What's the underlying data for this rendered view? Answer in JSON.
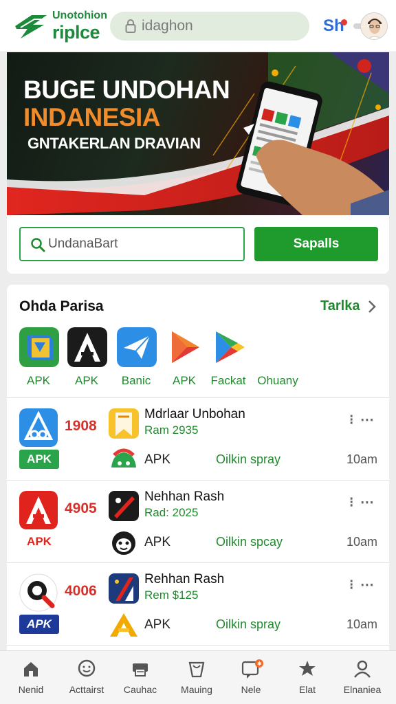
{
  "header": {
    "logo_line1": "Unotohion",
    "logo_line2": "riplce",
    "search_placeholder": "idaghon",
    "sh_label": "Sh",
    "colors": {
      "brand": "#1c8a3a",
      "accent": "#2f6bd1",
      "notify": "#e53935"
    }
  },
  "banner": {
    "title_line1": "BUGE UNDOHAN",
    "title_line2": "INDANESIA",
    "subtitle": "GNTAKERLAN DRAVIAN",
    "colors": {
      "title": "#ffffff",
      "title_accent": "#f28b2a",
      "stripe_red": "#d0241d",
      "stripe_green": "#1f8a2d"
    }
  },
  "promo": {
    "input_value": "UndanaBart",
    "button_label": "Sapalls"
  },
  "section": {
    "title": "Ohda Parisa",
    "link": "Tarlka"
  },
  "categories": [
    {
      "label": "APK",
      "icon": "book-app-icon",
      "color": "#2ea043"
    },
    {
      "label": "APK",
      "icon": "a-logo-app-icon",
      "color": "#111111"
    },
    {
      "label": "Banic",
      "icon": "paper-plane-app-icon",
      "color": "#2d8ee6"
    },
    {
      "label": "APK",
      "icon": "play-triangle-icon",
      "color": "#e53935"
    },
    {
      "label": "Fackat",
      "icon": "google-play-icon",
      "color": "#34a853"
    },
    {
      "label": "Ohuany",
      "icon": "",
      "color": ""
    }
  ],
  "apps": [
    {
      "rank": "1908",
      "name": "Mdrlaar Unbohan",
      "meta": "Ram 2935",
      "tag": "APK",
      "apk": "APK",
      "spray": "Oilkin spray",
      "time": "10am",
      "icon": "a-triangle-blue-icon",
      "small_icon": "bookmark-yellow-icon",
      "tag2_icon": "green-blob-icon"
    },
    {
      "rank": "4905",
      "name": "Nehhan Rash",
      "meta": "Rad: 2025",
      "tag": "APK",
      "apk": "APK",
      "spray": "Oilkin spcay",
      "time": "10am",
      "icon": "a-red-logo-icon",
      "small_icon": "slash-app-icon",
      "tag2_icon": "panda-face-icon"
    },
    {
      "rank": "4006",
      "name": "Rehhan Rash",
      "meta": "Rem $125",
      "tag": "APK",
      "apk": "APK",
      "spray": "Oilkin spray",
      "time": "10am",
      "icon": "magnifier-logo-icon",
      "small_icon": "flag-app-icon",
      "tag2_icon": "a-yellow-logo-icon"
    }
  ],
  "bottom_nav": [
    {
      "label": "Nenid",
      "icon": "home-icon"
    },
    {
      "label": "Acttairst",
      "icon": "chat-face-icon"
    },
    {
      "label": "Cauhac",
      "icon": "printer-icon"
    },
    {
      "label": "Mauing",
      "icon": "bag-icon"
    },
    {
      "label": "Nele",
      "icon": "notification-icon"
    },
    {
      "label": "Elat",
      "icon": "star-badge-icon"
    },
    {
      "label": "Elnaniea",
      "icon": "profile-icon"
    }
  ]
}
